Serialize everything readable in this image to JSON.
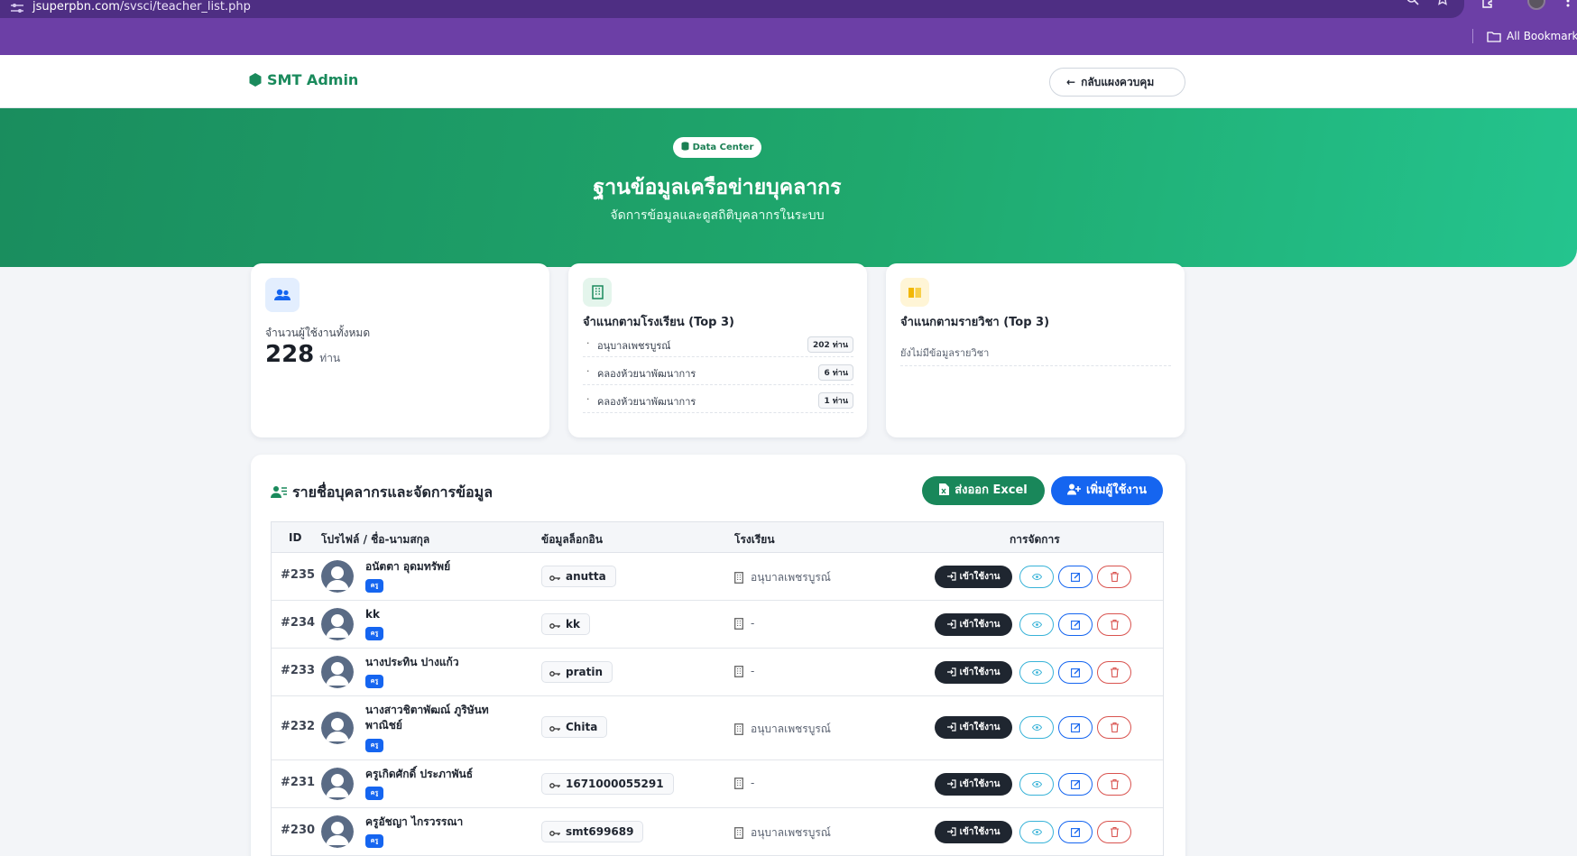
{
  "browser": {
    "url_domain": "jsuperpbn.com",
    "url_path": "/svsci/teacher_list.php",
    "bookmarks_label": "All Bookmarks"
  },
  "header": {
    "brand": "SMT Admin",
    "back_label": "กลับแผงควบคุม"
  },
  "hero": {
    "badge": "Data Center",
    "title": "ฐานข้อมูลเครือข่ายบุคลากร",
    "subtitle": "จัดการข้อมูลและดูสถิติบุคลากรในระบบ"
  },
  "stats": {
    "total_label": "จำนวนผู้ใช้งานทั้งหมด",
    "total_value": "228",
    "total_unit": "ท่าน",
    "school_heading": "จำแนกตามโรงเรียน (Top 3)",
    "schools": [
      {
        "name": "อนุบาลเพชรบูรณ์",
        "count": "202 ท่าน"
      },
      {
        "name": "คลองห้วยนาพัฒนาการ",
        "count": "6 ท่าน"
      },
      {
        "name": "คลองห้วยนาพัฒนาการ",
        "count": "1 ท่าน"
      }
    ],
    "subject_heading": "จำแนกตามรายวิชา (Top 3)",
    "subject_empty": "ยังไม่มีข้อมูลรายวิชา"
  },
  "panel": {
    "title": "รายชื่อบุคลากรและจัดการข้อมูล",
    "export_label": "ส่งออก Excel",
    "add_label": "เพิ่มผู้ใช้งาน",
    "columns": {
      "id": "ID",
      "profile": "โปรไฟล์ / ชื่อ-นามสกุล",
      "login": "ข้อมูลล็อกอิน",
      "school": "โรงเรียน",
      "actions": "การจัดการ"
    },
    "login_action_label": "เข้าใช้งาน",
    "rows": [
      {
        "id": "#235",
        "name": "อนัตตา อุดมทรัพย์",
        "role": "ครู",
        "username": "anutta",
        "school": "อนุบาลเพชรบูรณ์"
      },
      {
        "id": "#234",
        "name": "kk",
        "role": "ครู",
        "username": "kk",
        "school": "-"
      },
      {
        "id": "#233",
        "name": "นางประทิน ปางแก้ว",
        "role": "ครู",
        "username": "pratin",
        "school": "-"
      },
      {
        "id": "#232",
        "name": "นางสาวชิตาพัฒณ์ ภูริษันท พาณิชย์",
        "role": "ครู",
        "username": "Chita",
        "school": "อนุบาลเพชรบูรณ์"
      },
      {
        "id": "#231",
        "name": "ครูเกิดศักดิ์ ประภาพันธ์",
        "role": "ครู",
        "username": "1671000055291",
        "school": "-"
      },
      {
        "id": "#230",
        "name": "ครูอัชญา ไกรวรรณา",
        "role": "ครู",
        "username": "smt699689",
        "school": "อนุบาลเพชรบูรณ์"
      }
    ]
  },
  "colors": {
    "brand_green": "#1a8a5c",
    "hero_start": "#1a8d5e",
    "hero_end": "#24c48e",
    "primary_blue": "#1565f0",
    "danger": "#d9534f",
    "info": "#39b3d8",
    "chrome_purple": "#6c3fa6"
  },
  "icons": {
    "site_info": "tune-icon",
    "zoom": "zoom-icon",
    "bookmark_star": "star-icon",
    "extensions": "puzzle-icon",
    "profile": "profile-avatar-icon",
    "menu": "kebab-menu-icon",
    "folder": "folder-icon",
    "brand": "hexagon-icon",
    "back": "arrow-left-icon",
    "badge": "database-icon",
    "users": "users-icon",
    "school": "building-icon",
    "subject": "book-icon",
    "title": "user-list-icon",
    "export": "file-excel-icon",
    "add": "user-plus-icon",
    "key": "key-icon",
    "login": "sign-in-icon",
    "view": "eye-icon",
    "edit": "edit-icon",
    "delete": "trash-icon"
  }
}
